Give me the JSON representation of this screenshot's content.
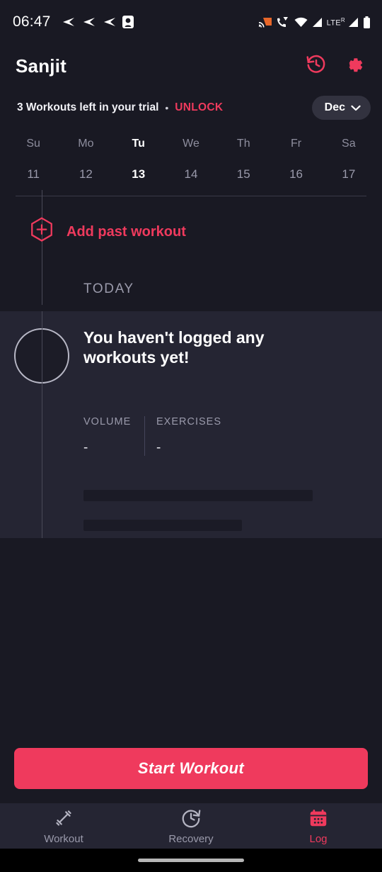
{
  "statusbar": {
    "time": "06:47",
    "left_icons": [
      "send-icon",
      "send-icon",
      "send-icon",
      "app-badge-icon"
    ],
    "right_icons": [
      "cast-icon",
      "call-wifi-icon",
      "wifi-icon",
      "signal-icon",
      "signal-icon",
      "battery-icon"
    ],
    "network_label": "LTE",
    "roaming_label": "R"
  },
  "header": {
    "title": "Sanjit",
    "history_icon": "history-icon",
    "settings_icon": "gear-icon"
  },
  "trial": {
    "message": "3 Workouts left in your trial",
    "separator": "•",
    "unlock_label": "UNLOCK",
    "month": "Dec",
    "chevron": "chevron-down-icon"
  },
  "calendar": {
    "weekdays": [
      "Su",
      "Mo",
      "Tu",
      "We",
      "Th",
      "Fr",
      "Sa"
    ],
    "dates": [
      "11",
      "12",
      "13",
      "14",
      "15",
      "16",
      "17"
    ],
    "selected_index": 2
  },
  "timeline": {
    "add_past_workout_label": "Add past workout",
    "add_icon": "hexagon-plus-icon",
    "today_label": "TODAY"
  },
  "empty_card": {
    "avatar": "avatar-placeholder",
    "title": "You haven't logged any workouts yet!",
    "stats": [
      {
        "label": "VOLUME",
        "value": "-"
      },
      {
        "label": "EXERCISES",
        "value": "-"
      }
    ]
  },
  "cta": {
    "label": "Start Workout"
  },
  "bottom_nav": {
    "items": [
      {
        "label": "Workout",
        "icon": "dumbbell-icon",
        "active": false
      },
      {
        "label": "Recovery",
        "icon": "clock-refresh-icon",
        "active": false
      },
      {
        "label": "Log",
        "icon": "calendar-icon",
        "active": true
      }
    ]
  },
  "colors": {
    "accent": "#ef3a5d",
    "page_bg": "#191923",
    "card_bg": "#252533",
    "nav_bg": "#252533",
    "muted_text": "#9a9aab"
  }
}
